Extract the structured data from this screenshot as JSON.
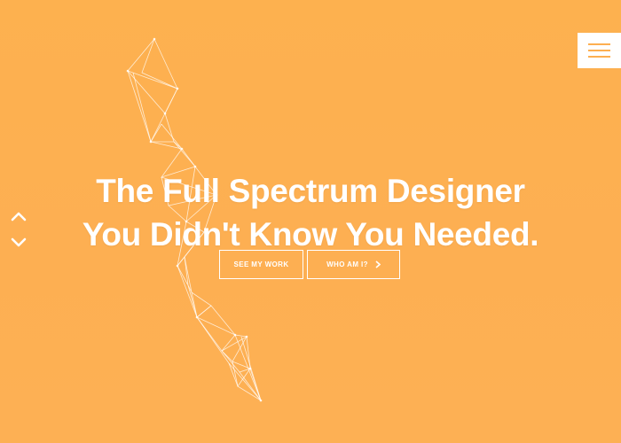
{
  "hero": {
    "headline_line1": "The Full Spectrum Designer",
    "headline_line2": "You Didn't Know You Needed."
  },
  "buttons": {
    "see_my_work": "SEE MY WORK",
    "who_am_i": "WHO AM I?",
    "who_am_i_icon": "chevron-right-icon"
  },
  "side_nav": {
    "up_icon": "chevron-up-icon",
    "down_icon": "chevron-down-icon"
  },
  "menu": {
    "icon": "hamburger-icon"
  },
  "colors": {
    "background": "#FDAF51",
    "foreground": "#FFFFFF"
  }
}
